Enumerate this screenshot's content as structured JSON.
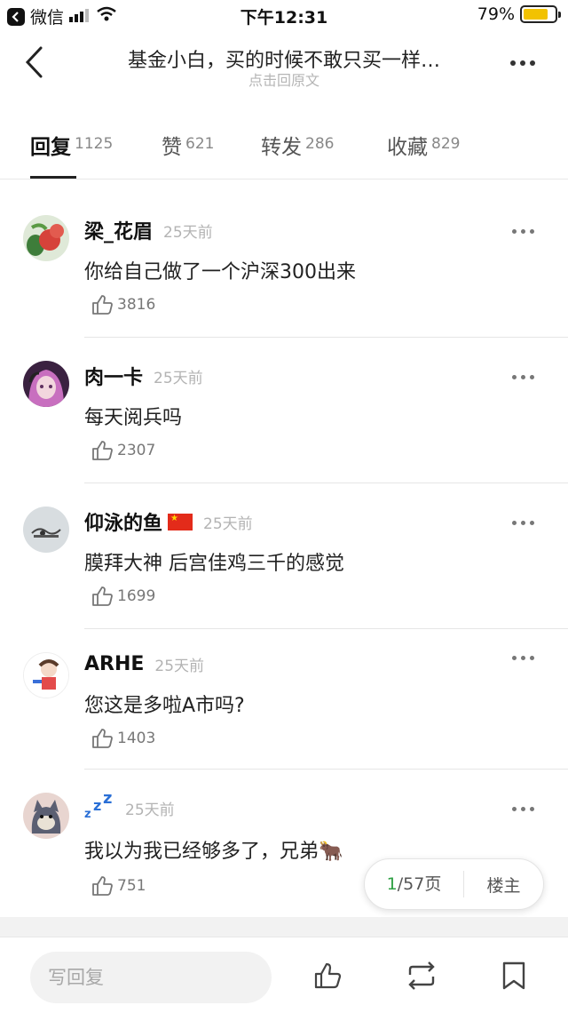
{
  "status_bar": {
    "carrier": "微信",
    "time": "下午12:31",
    "battery": "79%",
    "battery_level": 0.79
  },
  "header": {
    "title": "基金小白，买的时候不敢只买一样…",
    "subtitle": "点击回原文"
  },
  "tabs": [
    {
      "label": "回复",
      "count": "1125"
    },
    {
      "label": "赞",
      "count": "621"
    },
    {
      "label": "转发",
      "count": "286"
    },
    {
      "label": "收藏",
      "count": "829"
    }
  ],
  "comments": [
    {
      "name": "梁_花眉",
      "time": "25天前",
      "text": "你给自己做了一个沪深300出来",
      "likes": "3816",
      "avatar": "flower-tomato-avatar"
    },
    {
      "name": "肉一卡",
      "time": "25天前",
      "text": "每天阅兵吗",
      "likes": "2307",
      "avatar": "anime-girl-avatar"
    },
    {
      "name": "仰泳的鱼",
      "time": "25天前",
      "text": "膜拜大神 后宫佳鸡三千的感觉",
      "likes": "1699",
      "avatar": "sketch-avatar",
      "flag": "china-flag"
    },
    {
      "name": "ARHE",
      "time": "25天前",
      "text": "您这是多啦A市吗?",
      "likes": "1403",
      "avatar": "cartoon-avatar"
    },
    {
      "name": "💤",
      "time": "25天前",
      "text": "我以为我已经够多了，兄弟🐂",
      "likes": "751",
      "avatar": "cat-avatar"
    }
  ],
  "pager": {
    "current": "1",
    "total": "/57页",
    "op": "楼主"
  },
  "bottom": {
    "reply_placeholder": "写回复"
  },
  "colors": {
    "accent_green": "#2ea043",
    "battery_yellow": "#f2c200"
  }
}
